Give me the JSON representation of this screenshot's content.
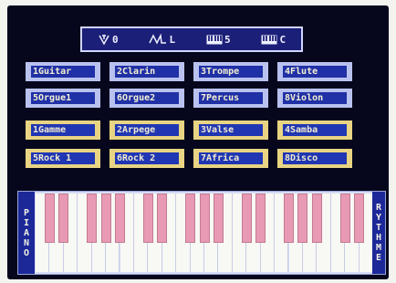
{
  "controls": [
    {
      "id": "tempo",
      "label": "0",
      "icon": "metronome-icon"
    },
    {
      "id": "wave",
      "label": "L",
      "icon": "waveform-icon"
    },
    {
      "id": "style",
      "label": "5",
      "icon": "keyboard-small-icon"
    },
    {
      "id": "mode",
      "label": "C",
      "icon": "keyboard-small-icon"
    }
  ],
  "instruments": [
    "1Guitar",
    "2Clarin",
    "3Trompe",
    "4Flute",
    "5Orgue1",
    "6Orgue2",
    "7Percus",
    "8Violon"
  ],
  "rhythms": [
    "1Gamme",
    "2Arpege",
    "3Valse",
    "4Samba",
    "5Rock 1",
    "6Rock 2",
    "7Africa",
    "8Disco"
  ],
  "keyboard": {
    "left_label": "PIANO",
    "right_label": "RYTHME",
    "white_keys": 24,
    "black_key_pattern": [
      1,
      1,
      0,
      1,
      1,
      1,
      0
    ]
  },
  "colors": {
    "screen_bg": "#06071c",
    "instrument_frame": "#b9c2ef",
    "rhythm_frame": "#e8d483",
    "button_fill": "#2030a6",
    "black_key": "#e89ab4"
  }
}
